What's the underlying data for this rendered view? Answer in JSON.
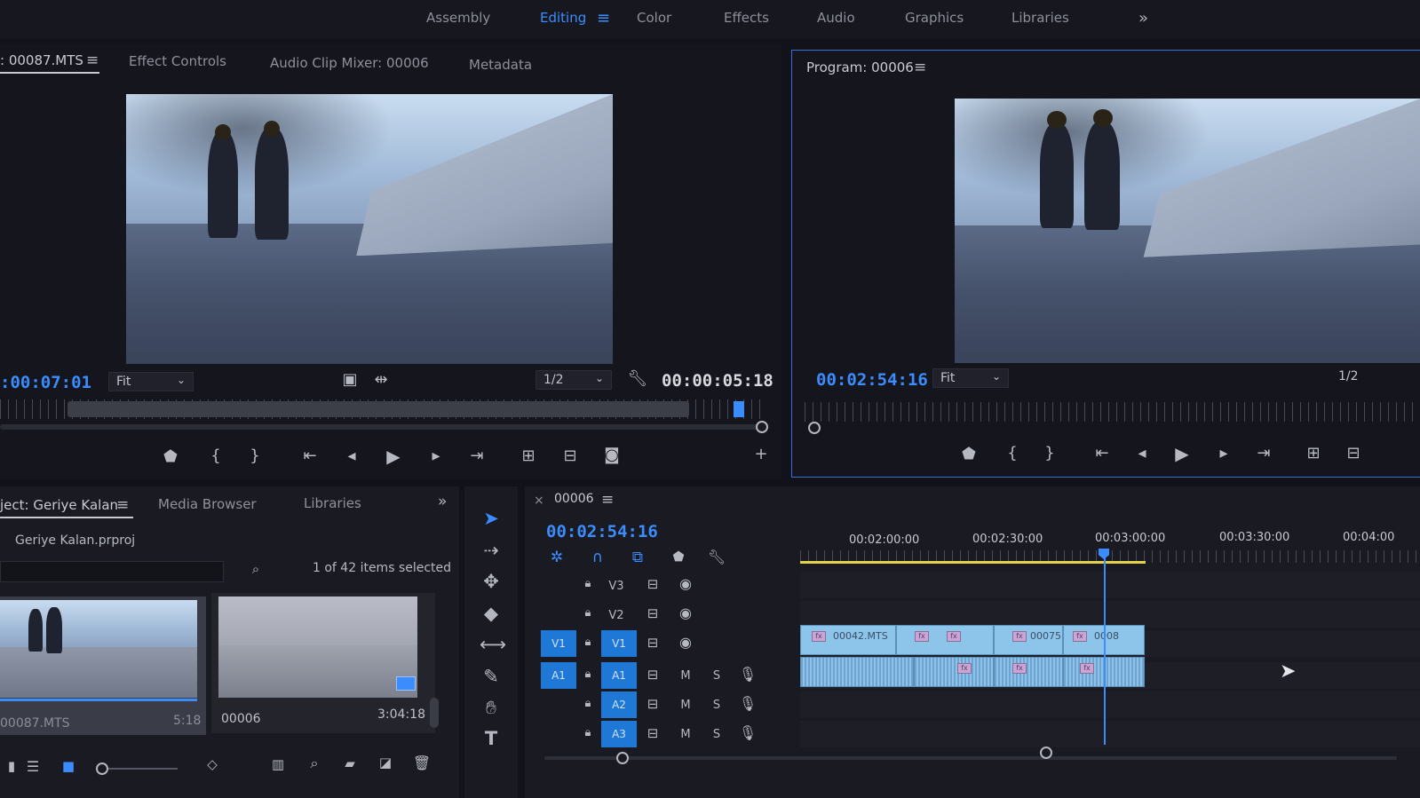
{
  "workspaces": {
    "items": [
      "Assembly",
      "Editing",
      "Color",
      "Effects",
      "Audio",
      "Graphics",
      "Libraries"
    ],
    "active": "Editing"
  },
  "source": {
    "tabs": {
      "source": ": 00087.MTS",
      "effect_controls": "Effect Controls",
      "audio_mixer": "Audio Clip Mixer: 00006",
      "metadata": "Metadata"
    },
    "timecode_left": ":00:07:01",
    "fit": "Fit",
    "resolution": "1/2",
    "timecode_right": "00:00:05:18"
  },
  "program": {
    "title": "Program: 00006",
    "timecode": "00:02:54:16",
    "fit": "Fit",
    "resolution": "1/2"
  },
  "project": {
    "tabs": {
      "project": "ject: Geriye Kalan",
      "media_browser": "Media Browser",
      "libraries": "Libraries"
    },
    "file": "Geriye Kalan.prproj",
    "items_selected": "1 of 42 items selected",
    "thumbs": [
      {
        "name": "00087.MTS",
        "duration": "5:18"
      },
      {
        "name": "00006",
        "duration": "3:04:18"
      }
    ]
  },
  "timeline": {
    "sequence_name": "00006",
    "timecode": "00:02:54:16",
    "ruler": [
      "00:02:00:00",
      "00:02:30:00",
      "00:03:00:00",
      "00:03:30:00",
      "00:04:00"
    ],
    "tracks": {
      "video": [
        "V3",
        "V2",
        "V1"
      ],
      "audio": [
        "A1",
        "A2",
        "A3"
      ],
      "mute": "M",
      "solo": "S"
    },
    "clips": [
      "00042.MTS",
      "00075",
      "0008"
    ]
  }
}
